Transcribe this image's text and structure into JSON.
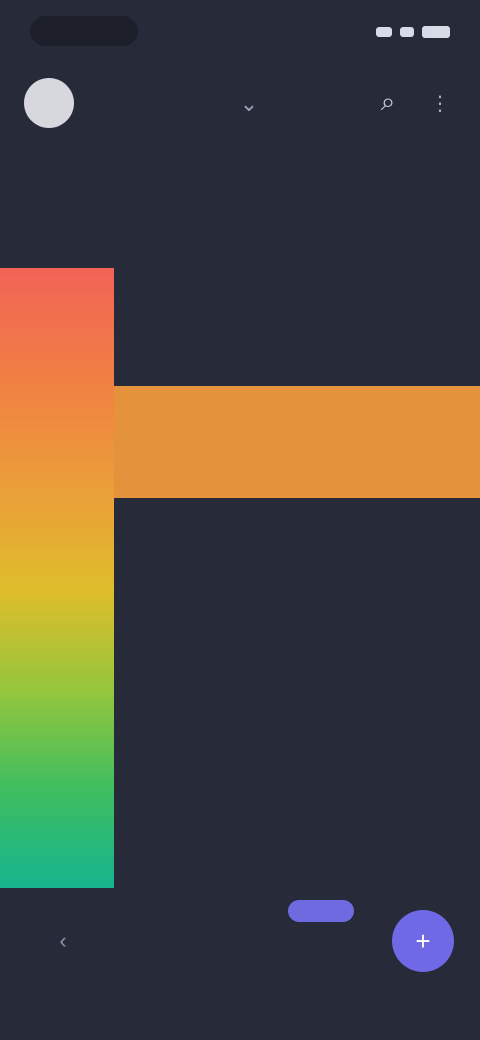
{
  "status_bar": {
    "time": "",
    "icons": [
      "signal-icon",
      "wifi-icon",
      "battery-icon"
    ]
  },
  "top_bar": {
    "avatar_label": "",
    "center_icon_name": "chevron-icon",
    "right_icon_name": "search-icon",
    "more_icon_name": "more-icon"
  },
  "question": {
    "text": ""
  },
  "scale": {
    "items": [
      {
        "num": "",
        "label": ""
      },
      {
        "num": "",
        "label": ""
      },
      {
        "num": "",
        "label": ""
      },
      {
        "num": "",
        "label": ""
      },
      {
        "num": "",
        "label": ""
      },
      {
        "num": "",
        "label": ""
      }
    ],
    "selected_index": 1
  },
  "footer": {
    "hint": "",
    "skip_label": "",
    "next_icon_name": "plus-icon"
  },
  "colors": {
    "background": "#272a39",
    "accent": "#6f69e6",
    "selected_band": "#f49b3c"
  }
}
